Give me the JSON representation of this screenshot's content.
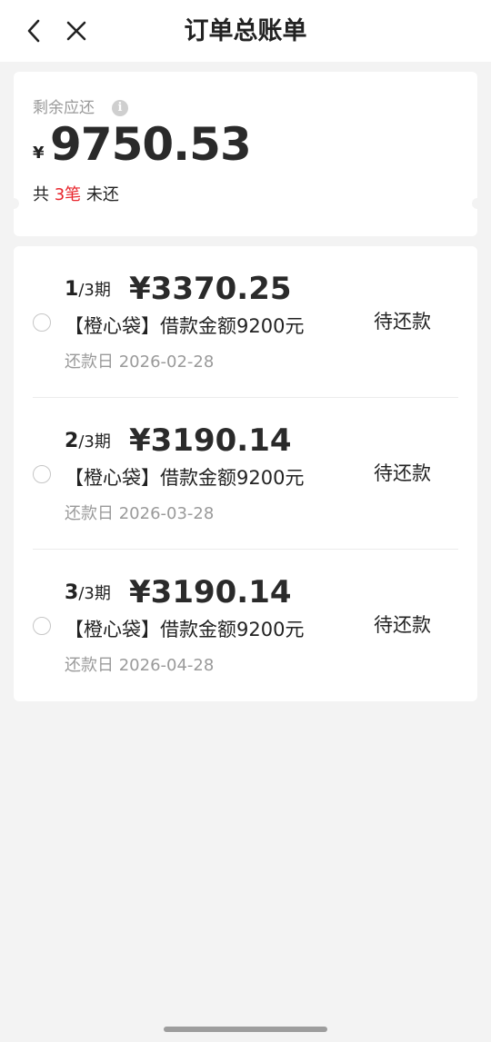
{
  "header": {
    "title": "订单总账单",
    "back_icon": "chevron-left-icon",
    "close_icon": "close-icon"
  },
  "summary": {
    "remain_label": "剩余应还",
    "info_icon": "info-icon",
    "currency_symbol": "¥",
    "remain_amount": "9750.53",
    "count_prefix": "共 ",
    "count_value": "3笔",
    "count_suffix": " 未还",
    "highlight_color": "#e8242b"
  },
  "installments": [
    {
      "period": "1",
      "total": "/3期",
      "amount": "¥3370.25",
      "description": "【橙心袋】借款金额9200元",
      "due_date": "还款日 2026-02-28",
      "status": "待还款"
    },
    {
      "period": "2",
      "total": "/3期",
      "amount": "¥3190.14",
      "description": "【橙心袋】借款金额9200元",
      "due_date": "还款日 2026-03-28",
      "status": "待还款"
    },
    {
      "period": "3",
      "total": "/3期",
      "amount": "¥3190.14",
      "description": "【橙心袋】借款金额9200元",
      "due_date": "还款日 2026-04-28",
      "status": "待还款"
    }
  ]
}
